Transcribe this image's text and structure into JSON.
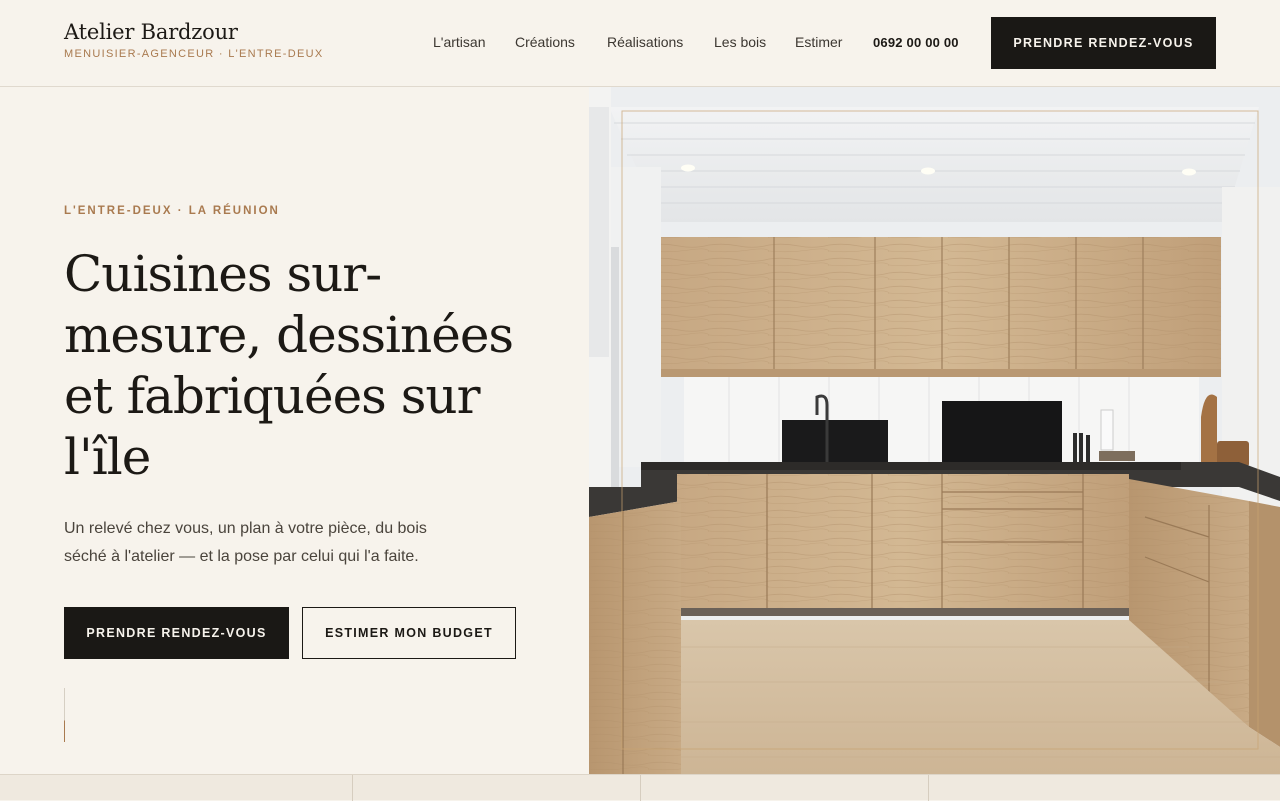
{
  "header": {
    "brand_name": "Atelier Bardzour",
    "brand_tagline": "MENUISIER-AGENCEUR · L'ENTRE-DEUX",
    "nav": [
      {
        "label": "L'artisan"
      },
      {
        "label": "Créations"
      },
      {
        "label": "Réalisations"
      },
      {
        "label": "Les bois"
      },
      {
        "label": "Estimer"
      }
    ],
    "phone": "0692 00 00 00",
    "cta_label": "PRENDRE RENDEZ-VOUS"
  },
  "hero": {
    "eyebrow": "L'ENTRE-DEUX · LA RÉUNION",
    "title": "Cuisines sur-mesure, dessinées et fabriquées sur l'île",
    "lead": "Un relevé chez vous, un plan à votre pièce, du bois séché à l'atelier — et la pose par celui qui l'a faite.",
    "primary_cta": "PRENDRE RENDEZ-VOUS",
    "secondary_cta": "ESTIMER MON BUDGET"
  },
  "colors": {
    "background": "#f7f3ec",
    "ink": "#1c1915",
    "accent": "#a97a4f",
    "button_dark": "#1a1815",
    "wood": "#c9ab86"
  }
}
